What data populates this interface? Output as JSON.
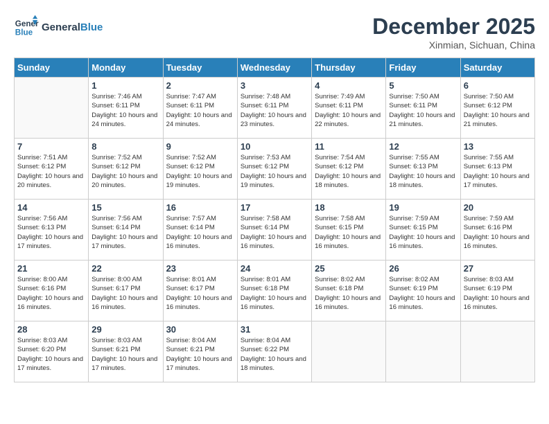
{
  "header": {
    "logo_general": "General",
    "logo_blue": "Blue",
    "month_title": "December 2025",
    "location": "Xinmian, Sichuan, China"
  },
  "days_of_week": [
    "Sunday",
    "Monday",
    "Tuesday",
    "Wednesday",
    "Thursday",
    "Friday",
    "Saturday"
  ],
  "weeks": [
    [
      {
        "day": "",
        "sunrise": "",
        "sunset": "",
        "daylight": ""
      },
      {
        "day": "1",
        "sunrise": "Sunrise: 7:46 AM",
        "sunset": "Sunset: 6:11 PM",
        "daylight": "Daylight: 10 hours and 24 minutes."
      },
      {
        "day": "2",
        "sunrise": "Sunrise: 7:47 AM",
        "sunset": "Sunset: 6:11 PM",
        "daylight": "Daylight: 10 hours and 24 minutes."
      },
      {
        "day": "3",
        "sunrise": "Sunrise: 7:48 AM",
        "sunset": "Sunset: 6:11 PM",
        "daylight": "Daylight: 10 hours and 23 minutes."
      },
      {
        "day": "4",
        "sunrise": "Sunrise: 7:49 AM",
        "sunset": "Sunset: 6:11 PM",
        "daylight": "Daylight: 10 hours and 22 minutes."
      },
      {
        "day": "5",
        "sunrise": "Sunrise: 7:50 AM",
        "sunset": "Sunset: 6:11 PM",
        "daylight": "Daylight: 10 hours and 21 minutes."
      },
      {
        "day": "6",
        "sunrise": "Sunrise: 7:50 AM",
        "sunset": "Sunset: 6:12 PM",
        "daylight": "Daylight: 10 hours and 21 minutes."
      }
    ],
    [
      {
        "day": "7",
        "sunrise": "Sunrise: 7:51 AM",
        "sunset": "Sunset: 6:12 PM",
        "daylight": "Daylight: 10 hours and 20 minutes."
      },
      {
        "day": "8",
        "sunrise": "Sunrise: 7:52 AM",
        "sunset": "Sunset: 6:12 PM",
        "daylight": "Daylight: 10 hours and 20 minutes."
      },
      {
        "day": "9",
        "sunrise": "Sunrise: 7:52 AM",
        "sunset": "Sunset: 6:12 PM",
        "daylight": "Daylight: 10 hours and 19 minutes."
      },
      {
        "day": "10",
        "sunrise": "Sunrise: 7:53 AM",
        "sunset": "Sunset: 6:12 PM",
        "daylight": "Daylight: 10 hours and 19 minutes."
      },
      {
        "day": "11",
        "sunrise": "Sunrise: 7:54 AM",
        "sunset": "Sunset: 6:12 PM",
        "daylight": "Daylight: 10 hours and 18 minutes."
      },
      {
        "day": "12",
        "sunrise": "Sunrise: 7:55 AM",
        "sunset": "Sunset: 6:13 PM",
        "daylight": "Daylight: 10 hours and 18 minutes."
      },
      {
        "day": "13",
        "sunrise": "Sunrise: 7:55 AM",
        "sunset": "Sunset: 6:13 PM",
        "daylight": "Daylight: 10 hours and 17 minutes."
      }
    ],
    [
      {
        "day": "14",
        "sunrise": "Sunrise: 7:56 AM",
        "sunset": "Sunset: 6:13 PM",
        "daylight": "Daylight: 10 hours and 17 minutes."
      },
      {
        "day": "15",
        "sunrise": "Sunrise: 7:56 AM",
        "sunset": "Sunset: 6:14 PM",
        "daylight": "Daylight: 10 hours and 17 minutes."
      },
      {
        "day": "16",
        "sunrise": "Sunrise: 7:57 AM",
        "sunset": "Sunset: 6:14 PM",
        "daylight": "Daylight: 10 hours and 16 minutes."
      },
      {
        "day": "17",
        "sunrise": "Sunrise: 7:58 AM",
        "sunset": "Sunset: 6:14 PM",
        "daylight": "Daylight: 10 hours and 16 minutes."
      },
      {
        "day": "18",
        "sunrise": "Sunrise: 7:58 AM",
        "sunset": "Sunset: 6:15 PM",
        "daylight": "Daylight: 10 hours and 16 minutes."
      },
      {
        "day": "19",
        "sunrise": "Sunrise: 7:59 AM",
        "sunset": "Sunset: 6:15 PM",
        "daylight": "Daylight: 10 hours and 16 minutes."
      },
      {
        "day": "20",
        "sunrise": "Sunrise: 7:59 AM",
        "sunset": "Sunset: 6:16 PM",
        "daylight": "Daylight: 10 hours and 16 minutes."
      }
    ],
    [
      {
        "day": "21",
        "sunrise": "Sunrise: 8:00 AM",
        "sunset": "Sunset: 6:16 PM",
        "daylight": "Daylight: 10 hours and 16 minutes."
      },
      {
        "day": "22",
        "sunrise": "Sunrise: 8:00 AM",
        "sunset": "Sunset: 6:17 PM",
        "daylight": "Daylight: 10 hours and 16 minutes."
      },
      {
        "day": "23",
        "sunrise": "Sunrise: 8:01 AM",
        "sunset": "Sunset: 6:17 PM",
        "daylight": "Daylight: 10 hours and 16 minutes."
      },
      {
        "day": "24",
        "sunrise": "Sunrise: 8:01 AM",
        "sunset": "Sunset: 6:18 PM",
        "daylight": "Daylight: 10 hours and 16 minutes."
      },
      {
        "day": "25",
        "sunrise": "Sunrise: 8:02 AM",
        "sunset": "Sunset: 6:18 PM",
        "daylight": "Daylight: 10 hours and 16 minutes."
      },
      {
        "day": "26",
        "sunrise": "Sunrise: 8:02 AM",
        "sunset": "Sunset: 6:19 PM",
        "daylight": "Daylight: 10 hours and 16 minutes."
      },
      {
        "day": "27",
        "sunrise": "Sunrise: 8:03 AM",
        "sunset": "Sunset: 6:19 PM",
        "daylight": "Daylight: 10 hours and 16 minutes."
      }
    ],
    [
      {
        "day": "28",
        "sunrise": "Sunrise: 8:03 AM",
        "sunset": "Sunset: 6:20 PM",
        "daylight": "Daylight: 10 hours and 17 minutes."
      },
      {
        "day": "29",
        "sunrise": "Sunrise: 8:03 AM",
        "sunset": "Sunset: 6:21 PM",
        "daylight": "Daylight: 10 hours and 17 minutes."
      },
      {
        "day": "30",
        "sunrise": "Sunrise: 8:04 AM",
        "sunset": "Sunset: 6:21 PM",
        "daylight": "Daylight: 10 hours and 17 minutes."
      },
      {
        "day": "31",
        "sunrise": "Sunrise: 8:04 AM",
        "sunset": "Sunset: 6:22 PM",
        "daylight": "Daylight: 10 hours and 18 minutes."
      },
      {
        "day": "",
        "sunrise": "",
        "sunset": "",
        "daylight": ""
      },
      {
        "day": "",
        "sunrise": "",
        "sunset": "",
        "daylight": ""
      },
      {
        "day": "",
        "sunrise": "",
        "sunset": "",
        "daylight": ""
      }
    ]
  ]
}
